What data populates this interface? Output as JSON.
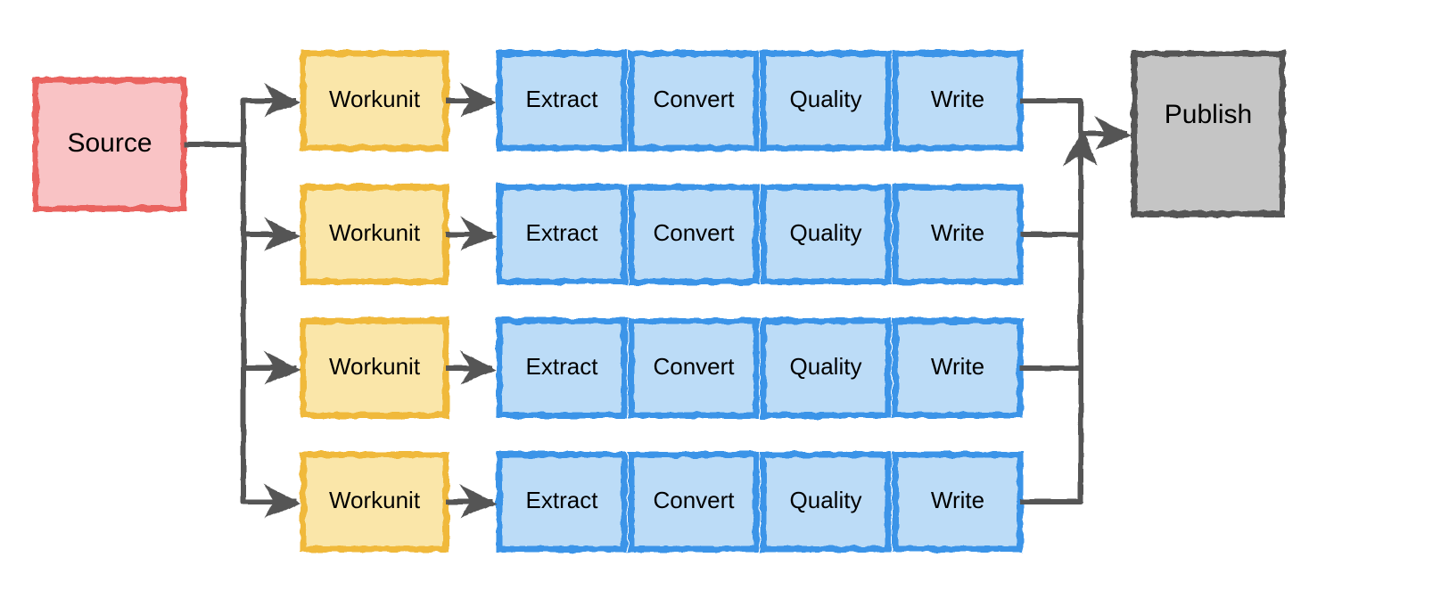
{
  "source": {
    "label": "Source",
    "fill": "#f9c3c5",
    "stroke": "#ea635e"
  },
  "publish": {
    "label": "Publish",
    "fill": "#c5c5c5",
    "stroke": "#555555"
  },
  "workunit": {
    "label": "Workunit",
    "fill": "#fae6a9",
    "stroke": "#f0b93a"
  },
  "stages": {
    "labels": [
      "Extract",
      "Convert",
      "Quality",
      "Write"
    ],
    "fill": "#bcdcf7",
    "stroke": "#3a94e8"
  },
  "row_count": 4,
  "arrow_color": "#555555"
}
